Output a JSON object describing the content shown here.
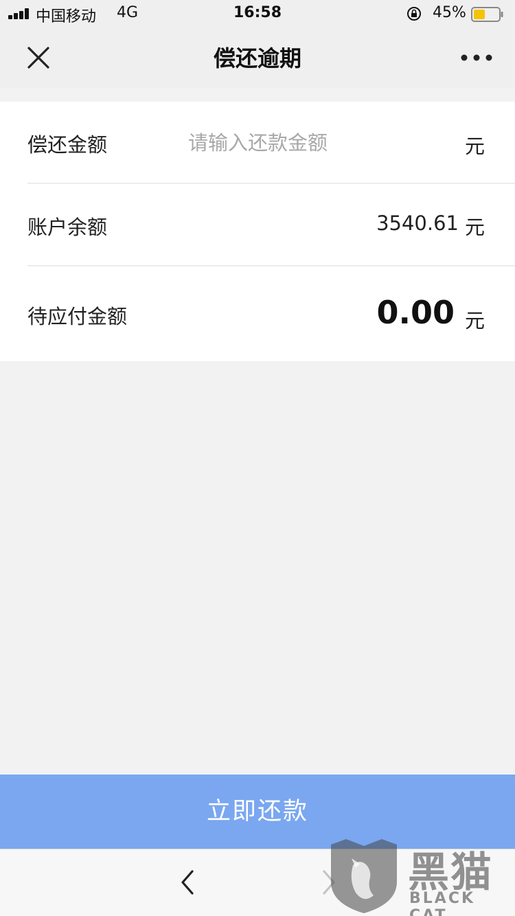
{
  "status_bar": {
    "carrier": "中国移动",
    "network": "4G",
    "time": "16:58",
    "battery_percent": "45%",
    "battery_level": 0.45,
    "battery_color": "#f5c400"
  },
  "nav": {
    "title": "偿还逾期",
    "close_icon": "close-icon",
    "more_icon": "more-icon"
  },
  "form": {
    "repay_amount": {
      "label": "偿还金额",
      "value": "",
      "placeholder": "请输入还款金额",
      "unit": "元"
    },
    "balance": {
      "label": "账户余额",
      "value": "3540.61",
      "unit": "元"
    },
    "due": {
      "label": "待应付金额",
      "value": "0.00",
      "unit": "元"
    }
  },
  "actions": {
    "repay_label": "立即还款",
    "accent_color": "#7aa7f0"
  },
  "bottom_bar": {
    "back_icon": "chevron-left-icon",
    "forward_icon": "chevron-right-icon"
  },
  "watermark": {
    "title": "黑猫",
    "subtitle": "BLACK CAT"
  }
}
